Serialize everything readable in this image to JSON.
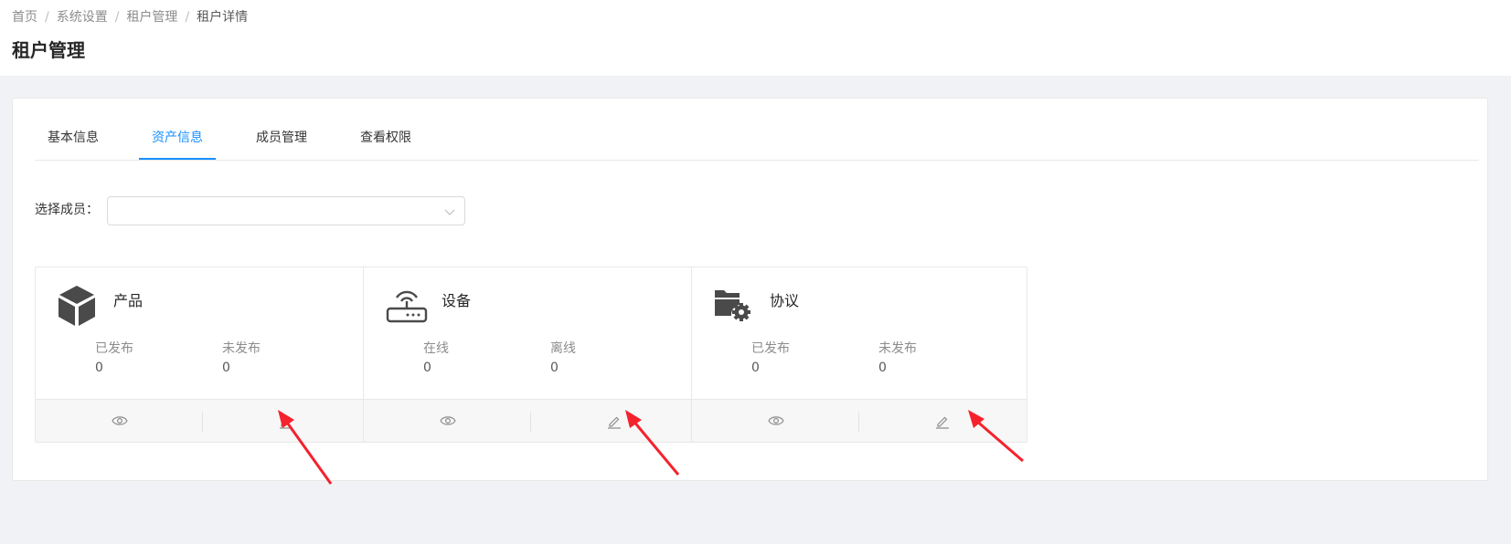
{
  "breadcrumb": {
    "items": [
      "首页",
      "系统设置",
      "租户管理"
    ],
    "separator": "/",
    "current": "租户详情"
  },
  "page": {
    "title": "租户管理"
  },
  "tabs": [
    {
      "label": "基本信息",
      "active": false
    },
    {
      "label": "资产信息",
      "active": true
    },
    {
      "label": "成员管理",
      "active": false
    },
    {
      "label": "查看权限",
      "active": false
    }
  ],
  "member_select": {
    "label": "选择成员：",
    "value": "",
    "icon": "chevron-down-icon"
  },
  "assets": [
    {
      "title": "产品",
      "icon": "cube-icon",
      "stats": [
        {
          "label": "已发布",
          "value": "0"
        },
        {
          "label": "未发布",
          "value": "0"
        }
      ],
      "actions": [
        "eye-icon",
        "edit-pencil-icon"
      ]
    },
    {
      "title": "设备",
      "icon": "router-icon",
      "stats": [
        {
          "label": "在线",
          "value": "0"
        },
        {
          "label": "离线",
          "value": "0"
        }
      ],
      "actions": [
        "eye-icon",
        "edit-pencil-icon"
      ]
    },
    {
      "title": "协议",
      "icon": "folder-gear-icon",
      "stats": [
        {
          "label": "已发布",
          "value": "0"
        },
        {
          "label": "未发布",
          "value": "0"
        }
      ],
      "actions": [
        "eye-icon",
        "edit-pencil-icon"
      ]
    }
  ],
  "colors": {
    "accent": "#1890ff",
    "page_background": "#f0f2f5",
    "annotation_arrow": "#f5222d"
  }
}
